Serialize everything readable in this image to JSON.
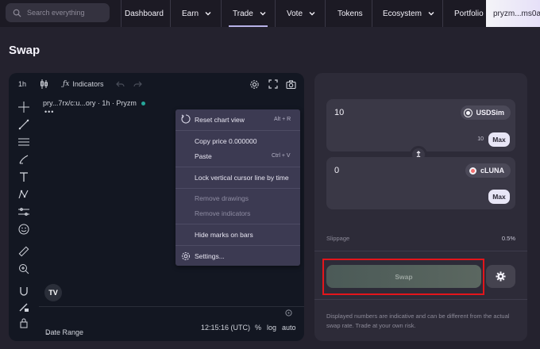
{
  "search": {
    "placeholder": "Search everything"
  },
  "nav": {
    "items": [
      {
        "label": "Dashboard"
      },
      {
        "label": "Earn"
      },
      {
        "label": "Trade"
      },
      {
        "label": "Vote"
      },
      {
        "label": "Tokens"
      },
      {
        "label": "Ecosystem"
      },
      {
        "label": "Portfolio"
      }
    ],
    "active": "Trade",
    "wallet": "pryzm...ms0a"
  },
  "page": {
    "title": "Swap"
  },
  "chart": {
    "interval": "1h",
    "indicators_label": "Indicators",
    "pair_label": "pry...7rx/c:u...ory · 1h · Pryzm",
    "dots": "•••",
    "logo_text": "TV",
    "date_range": "Date Range",
    "time": "12:15:16 (UTC)",
    "pct": "%",
    "log": "log",
    "auto": "auto"
  },
  "context_menu": {
    "items": [
      {
        "label": "Reset chart view",
        "shortcut": "Alt + R",
        "disabled": false
      },
      {
        "label": "Copy price 0.000000",
        "shortcut": "",
        "disabled": false
      },
      {
        "label": "Paste",
        "shortcut": "Ctrl + V",
        "disabled": false
      },
      {
        "label": "Lock vertical cursor line by time",
        "shortcut": "",
        "disabled": false
      },
      {
        "label": "Remove drawings",
        "shortcut": "",
        "disabled": true
      },
      {
        "label": "Remove indicators",
        "shortcut": "",
        "disabled": true
      },
      {
        "label": "Hide marks on bars",
        "shortcut": "",
        "disabled": false
      },
      {
        "label": "Settings...",
        "shortcut": "",
        "disabled": false
      }
    ]
  },
  "swap": {
    "from": {
      "amount": "10",
      "token": "USDSim",
      "balance": "10",
      "max_label": "Max"
    },
    "to": {
      "amount": "0",
      "token": "cLUNA",
      "max_label": "Max"
    },
    "slippage_label": "Slippage",
    "slippage_value": "0.5%",
    "swap_label": "Swap",
    "disclaimer": "Displayed numbers are indicative and can be different from the actual swap rate. Trade at your own risk."
  },
  "colors": {
    "background": "#24222e",
    "nav_background": "#1c1a24",
    "panel": "#2d2b38",
    "chart_background": "#131722",
    "context_menu": "#3c3a52",
    "highlight": "#e3151b",
    "accent_active": "#b8b2e8"
  }
}
